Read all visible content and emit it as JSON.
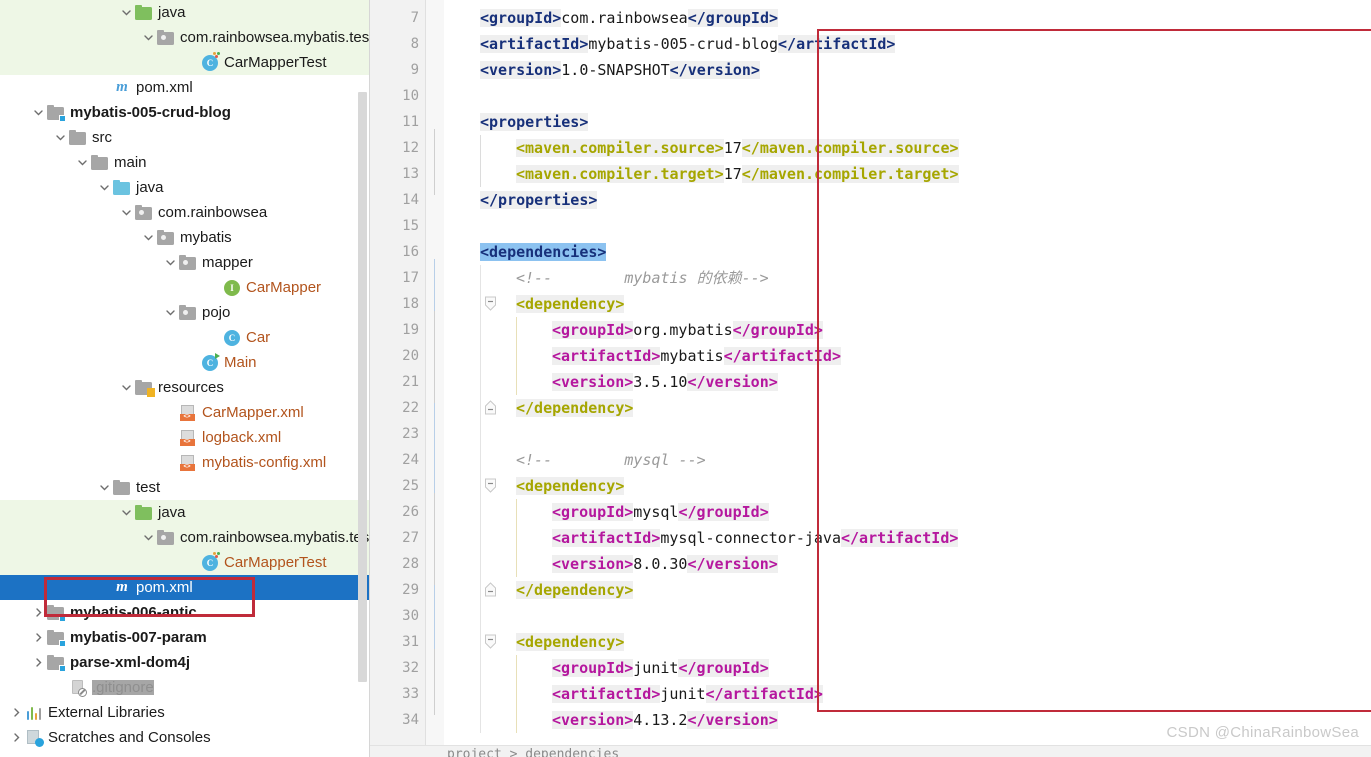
{
  "sidebar": {
    "scrollbar": {
      "name": "vertical-scrollbar"
    },
    "annotation_color": "#c02b3a",
    "items": [
      {
        "label": "java",
        "indent": 5,
        "icon": "folder-green",
        "arrow": "down",
        "highlight": "green",
        "bold": false
      },
      {
        "label": "com.rainbowsea.mybatis.tes",
        "indent": 6,
        "icon": "package",
        "arrow": "down",
        "highlight": "green",
        "bold": false
      },
      {
        "label": "CarMapperTest",
        "indent": 8,
        "icon": "test-class",
        "arrow": "none",
        "highlight": "green",
        "bold": false
      },
      {
        "label": "pom.xml",
        "indent": 4,
        "icon": "maven",
        "arrow": "none",
        "highlight": "none",
        "bold": false
      },
      {
        "label": "mybatis-005-crud-blog",
        "indent": 1,
        "icon": "module",
        "arrow": "down",
        "highlight": "none",
        "bold": true
      },
      {
        "label": "src",
        "indent": 2,
        "icon": "folder-gray",
        "arrow": "down",
        "highlight": "none",
        "bold": false
      },
      {
        "label": "main",
        "indent": 3,
        "icon": "folder-gray",
        "arrow": "down",
        "highlight": "none",
        "bold": false
      },
      {
        "label": "java",
        "indent": 4,
        "icon": "folder-blue",
        "arrow": "down",
        "highlight": "none",
        "bold": false
      },
      {
        "label": "com.rainbowsea",
        "indent": 5,
        "icon": "package",
        "arrow": "down",
        "highlight": "none",
        "bold": false
      },
      {
        "label": "mybatis",
        "indent": 6,
        "icon": "package",
        "arrow": "down",
        "highlight": "none",
        "bold": false
      },
      {
        "label": "mapper",
        "indent": 7,
        "icon": "package",
        "arrow": "down",
        "highlight": "none",
        "bold": false
      },
      {
        "label": "CarMapper",
        "indent": 9,
        "icon": "interface",
        "arrow": "none",
        "highlight": "none",
        "bold": false,
        "text_color": "orange"
      },
      {
        "label": "pojo",
        "indent": 7,
        "icon": "package",
        "arrow": "down",
        "highlight": "none",
        "bold": false
      },
      {
        "label": "Car",
        "indent": 9,
        "icon": "class",
        "arrow": "none",
        "highlight": "none",
        "bold": false,
        "text_color": "orange"
      },
      {
        "label": "Main",
        "indent": 8,
        "icon": "runnable-class",
        "arrow": "none",
        "highlight": "none",
        "bold": false,
        "text_color": "orange"
      },
      {
        "label": "resources",
        "indent": 5,
        "icon": "resources",
        "arrow": "down",
        "highlight": "none",
        "bold": false
      },
      {
        "label": "CarMapper.xml",
        "indent": 7,
        "icon": "xml",
        "arrow": "none",
        "highlight": "none",
        "bold": false,
        "text_color": "orange"
      },
      {
        "label": "logback.xml",
        "indent": 7,
        "icon": "xml",
        "arrow": "none",
        "highlight": "none",
        "bold": false,
        "text_color": "orange"
      },
      {
        "label": "mybatis-config.xml",
        "indent": 7,
        "icon": "xml",
        "arrow": "none",
        "highlight": "none",
        "bold": false,
        "text_color": "orange"
      },
      {
        "label": "test",
        "indent": 4,
        "icon": "folder-gray",
        "arrow": "down",
        "highlight": "none",
        "bold": false
      },
      {
        "label": "java",
        "indent": 5,
        "icon": "folder-green",
        "arrow": "down",
        "highlight": "green",
        "bold": false
      },
      {
        "label": "com.rainbowsea.mybatis.tes",
        "indent": 6,
        "icon": "package",
        "arrow": "down",
        "highlight": "green",
        "bold": false
      },
      {
        "label": "CarMapperTest",
        "indent": 8,
        "icon": "test-class",
        "arrow": "none",
        "highlight": "green",
        "bold": false,
        "text_color": "orange"
      },
      {
        "label": "pom.xml",
        "indent": 4,
        "icon": "maven",
        "arrow": "none",
        "highlight": "selected",
        "bold": false
      },
      {
        "label": "mybatis-006-antic",
        "indent": 1,
        "icon": "module",
        "arrow": "right",
        "highlight": "none",
        "bold": true
      },
      {
        "label": "mybatis-007-param",
        "indent": 1,
        "icon": "module",
        "arrow": "right",
        "highlight": "none",
        "bold": true
      },
      {
        "label": "parse-xml-dom4j",
        "indent": 1,
        "icon": "module",
        "arrow": "right",
        "highlight": "none",
        "bold": true
      },
      {
        "label": ".gitignore",
        "indent": 2,
        "icon": "gitignore",
        "arrow": "none",
        "highlight": "none",
        "bold": false,
        "text_color": "gray"
      },
      {
        "label": "External Libraries",
        "indent": 0,
        "icon": "libraries",
        "arrow": "right",
        "highlight": "none",
        "bold": false
      },
      {
        "label": "Scratches and Consoles",
        "indent": 0,
        "icon": "scratches",
        "arrow": "right",
        "highlight": "none",
        "bold": false
      }
    ]
  },
  "editor": {
    "first_line": 7,
    "line_numbers": [
      7,
      8,
      9,
      10,
      11,
      12,
      13,
      14,
      15,
      16,
      17,
      18,
      19,
      20,
      21,
      22,
      23,
      24,
      25,
      26,
      27,
      28,
      29,
      30,
      31,
      32,
      33,
      34
    ],
    "breadcrumb": "project  >  dependencies",
    "annotation_color": "#c02b3a",
    "colors": {
      "top_tag": "#17307a",
      "dependency_tag": "#a6a600",
      "inner_tag": "#b5179e",
      "comment": "#9a9a9a",
      "value": "#1a1a1a",
      "selection": "#8cc2f0",
      "token_bg": "#efefef"
    },
    "lines": [
      {
        "n": 7,
        "indent": 1,
        "tokens": [
          {
            "t": "<groupId>",
            "c": "navy",
            "bg": true
          },
          {
            "t": "com.rainbowsea",
            "c": "val",
            "bg": false
          },
          {
            "t": "</groupId>",
            "c": "navy",
            "bg": true
          }
        ]
      },
      {
        "n": 8,
        "indent": 1,
        "tokens": [
          {
            "t": "<artifactId>",
            "c": "navy",
            "bg": true
          },
          {
            "t": "mybatis-005-crud-blog",
            "c": "val",
            "bg": false
          },
          {
            "t": "</artifactId>",
            "c": "navy",
            "bg": true
          }
        ]
      },
      {
        "n": 9,
        "indent": 1,
        "tokens": [
          {
            "t": "<version>",
            "c": "navy",
            "bg": true
          },
          {
            "t": "1.0-SNAPSHOT",
            "c": "val",
            "bg": false
          },
          {
            "t": "</version>",
            "c": "navy",
            "bg": true
          }
        ]
      },
      {
        "n": 10,
        "indent": 1,
        "tokens": []
      },
      {
        "n": 11,
        "indent": 1,
        "tokens": [
          {
            "t": "<properties>",
            "c": "navy",
            "bg": true
          }
        ]
      },
      {
        "n": 12,
        "indent": 2,
        "tokens": [
          {
            "t": "<maven.compiler.source>",
            "c": "olive",
            "bg": true
          },
          {
            "t": "17",
            "c": "val",
            "bg": false
          },
          {
            "t": "</maven.compiler.source>",
            "c": "olive",
            "bg": true
          }
        ]
      },
      {
        "n": 13,
        "indent": 2,
        "tokens": [
          {
            "t": "<maven.compiler.target>",
            "c": "olive",
            "bg": true
          },
          {
            "t": "17",
            "c": "val",
            "bg": false
          },
          {
            "t": "</maven.compiler.target>",
            "c": "olive",
            "bg": true
          }
        ]
      },
      {
        "n": 14,
        "indent": 1,
        "tokens": [
          {
            "t": "</properties>",
            "c": "navy",
            "bg": true
          }
        ]
      },
      {
        "n": 15,
        "indent": 1,
        "tokens": []
      },
      {
        "n": 16,
        "indent": 1,
        "tokens": [
          {
            "t": "<dependencies>",
            "c": "selhl",
            "bg": false
          }
        ]
      },
      {
        "n": 17,
        "indent": 2,
        "tokens": [
          {
            "t": "<!--        mybatis 的依赖-->",
            "c": "cmt",
            "bg": false
          }
        ]
      },
      {
        "n": 18,
        "indent": 2,
        "tokens": [
          {
            "t": "<dependency>",
            "c": "olive",
            "bg": true
          }
        ]
      },
      {
        "n": 19,
        "indent": 3,
        "tokens": [
          {
            "t": "<groupId>",
            "c": "mag",
            "bg": true
          },
          {
            "t": "org.mybatis",
            "c": "val",
            "bg": false
          },
          {
            "t": "</groupId>",
            "c": "mag",
            "bg": true
          }
        ]
      },
      {
        "n": 20,
        "indent": 3,
        "tokens": [
          {
            "t": "<artifactId>",
            "c": "mag",
            "bg": true
          },
          {
            "t": "mybatis",
            "c": "val",
            "bg": false
          },
          {
            "t": "</artifactId>",
            "c": "mag",
            "bg": true
          }
        ]
      },
      {
        "n": 21,
        "indent": 3,
        "tokens": [
          {
            "t": "<version>",
            "c": "mag",
            "bg": true
          },
          {
            "t": "3.5.10",
            "c": "val",
            "bg": false
          },
          {
            "t": "</version>",
            "c": "mag",
            "bg": true
          }
        ]
      },
      {
        "n": 22,
        "indent": 2,
        "tokens": [
          {
            "t": "</dependency>",
            "c": "olive",
            "bg": true
          }
        ]
      },
      {
        "n": 23,
        "indent": 2,
        "tokens": []
      },
      {
        "n": 24,
        "indent": 2,
        "tokens": [
          {
            "t": "<!--        mysql -->",
            "c": "cmt",
            "bg": false
          }
        ]
      },
      {
        "n": 25,
        "indent": 2,
        "tokens": [
          {
            "t": "<dependency>",
            "c": "olive",
            "bg": true
          }
        ]
      },
      {
        "n": 26,
        "indent": 3,
        "tokens": [
          {
            "t": "<groupId>",
            "c": "mag",
            "bg": true
          },
          {
            "t": "mysql",
            "c": "val",
            "bg": false
          },
          {
            "t": "</groupId>",
            "c": "mag",
            "bg": true
          }
        ]
      },
      {
        "n": 27,
        "indent": 3,
        "tokens": [
          {
            "t": "<artifactId>",
            "c": "mag",
            "bg": true
          },
          {
            "t": "mysql-connector-java",
            "c": "val",
            "bg": false
          },
          {
            "t": "</artifactId>",
            "c": "mag",
            "bg": true
          }
        ]
      },
      {
        "n": 28,
        "indent": 3,
        "tokens": [
          {
            "t": "<version>",
            "c": "mag",
            "bg": true
          },
          {
            "t": "8.0.30",
            "c": "val",
            "bg": false
          },
          {
            "t": "</version>",
            "c": "mag",
            "bg": true
          }
        ]
      },
      {
        "n": 29,
        "indent": 2,
        "tokens": [
          {
            "t": "</dependency>",
            "c": "olive",
            "bg": true
          }
        ]
      },
      {
        "n": 30,
        "indent": 2,
        "tokens": []
      },
      {
        "n": 31,
        "indent": 2,
        "tokens": [
          {
            "t": "<dependency>",
            "c": "olive",
            "bg": true
          }
        ]
      },
      {
        "n": 32,
        "indent": 3,
        "tokens": [
          {
            "t": "<groupId>",
            "c": "mag",
            "bg": true
          },
          {
            "t": "junit",
            "c": "val",
            "bg": false
          },
          {
            "t": "</groupId>",
            "c": "mag",
            "bg": true
          }
        ]
      },
      {
        "n": 33,
        "indent": 3,
        "tokens": [
          {
            "t": "<artifactId>",
            "c": "mag",
            "bg": true
          },
          {
            "t": "junit",
            "c": "val",
            "bg": false
          },
          {
            "t": "</artifactId>",
            "c": "mag",
            "bg": true
          }
        ]
      },
      {
        "n": 34,
        "indent": 3,
        "tokens": [
          {
            "t": "<version>",
            "c": "mag",
            "bg": true
          },
          {
            "t": "4.13.2",
            "c": "val",
            "bg": false
          },
          {
            "t": "</version>",
            "c": "mag",
            "bg": true
          }
        ]
      }
    ],
    "fold_markers": [
      {
        "line": 11,
        "type": "open"
      },
      {
        "line": 14,
        "type": "close"
      },
      {
        "line": 16,
        "type": "open"
      },
      {
        "line": 18,
        "type": "open"
      },
      {
        "line": 22,
        "type": "close"
      },
      {
        "line": 25,
        "type": "open"
      },
      {
        "line": 29,
        "type": "close"
      },
      {
        "line": 31,
        "type": "open"
      }
    ]
  },
  "watermark": {
    "text": "CSDN @ChinaRainbowSea"
  }
}
